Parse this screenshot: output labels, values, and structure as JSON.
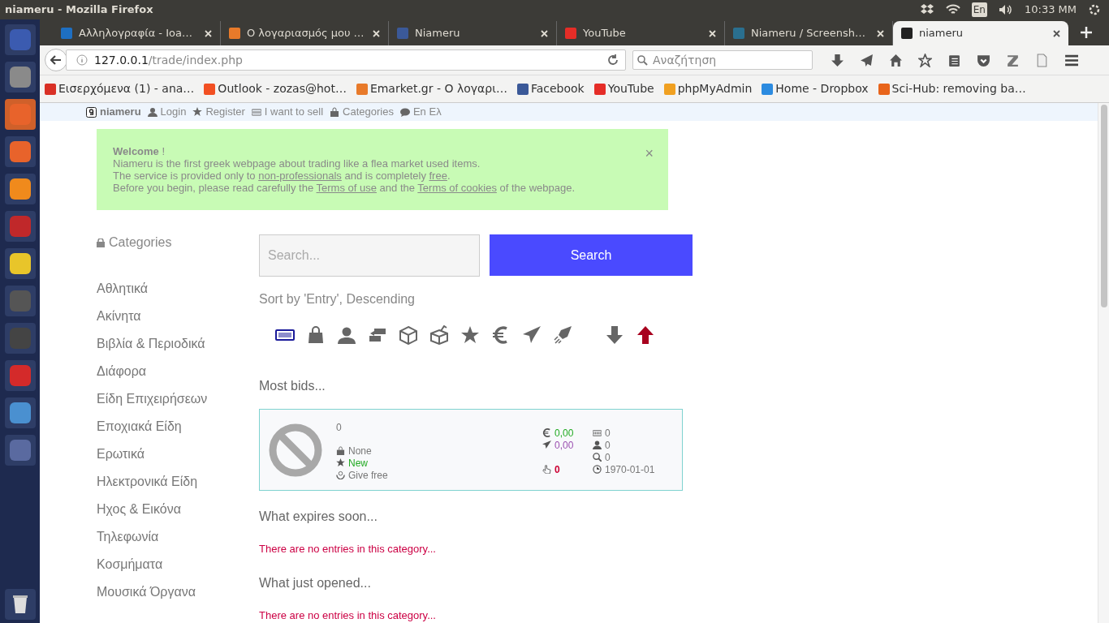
{
  "desktop_bar": {
    "title": "niameru - Mozilla Firefox",
    "keyboard": "En",
    "time": "10:33 MM"
  },
  "launcher": {
    "apps": [
      {
        "color": "#3b5bb0"
      },
      {
        "color": "#8a8a8a"
      },
      {
        "color": "#e8632b"
      },
      {
        "color": "#e8632b"
      },
      {
        "color": "#f08a1c"
      },
      {
        "color": "#c0282a"
      },
      {
        "color": "#e8c52a"
      },
      {
        "color": "#555555"
      },
      {
        "color": "#444444"
      },
      {
        "color": "#d42a2a"
      },
      {
        "color": "#4a90d0"
      },
      {
        "color": "#5a6aa0"
      }
    ],
    "trash": true
  },
  "tabs": [
    {
      "title": "Αλληλογραφία - Ioa…",
      "color": "#1e6fc2",
      "selected": false
    },
    {
      "title": "Ο λογαριασμός μου …",
      "color": "#e87a2a",
      "selected": false
    },
    {
      "title": "Niameru",
      "color": "#3b5998",
      "selected": false
    },
    {
      "title": "YouTube",
      "color": "#e52d27",
      "selected": false
    },
    {
      "title": "Niameru / Screensh…",
      "color": "#2a6f8f",
      "selected": false
    },
    {
      "title": "niameru",
      "color": "#222222",
      "selected": true
    }
  ],
  "url": {
    "host": "127.0.0.1",
    "path": "/trade/index.php"
  },
  "search": {
    "placeholder": "Αναζήτηση"
  },
  "bookmarks": [
    {
      "title": "Εισερχόμενα (1) - ana…",
      "color": "#d93025"
    },
    {
      "title": "Outlook - zozas@hot…",
      "color": "#f25022"
    },
    {
      "title": "Emarket.gr - Ο λογαρι…",
      "color": "#e87a2a"
    },
    {
      "title": "Facebook",
      "color": "#3b5998"
    },
    {
      "title": "YouTube",
      "color": "#e52d27"
    },
    {
      "title": "phpMyAdmin",
      "color": "#f0a020"
    },
    {
      "title": "Home - Dropbox",
      "color": "#2c8be0"
    },
    {
      "title": "Sci-Hub: removing ba…",
      "color": "#e8641a"
    }
  ],
  "site_nav": {
    "brand": "niameru",
    "links": [
      "Login",
      "Register",
      "I want to sell",
      "Categories",
      "En Ελ"
    ]
  },
  "alert": {
    "title": "Welcome",
    "title_tail": " !",
    "close": "×",
    "lines": [
      [
        {
          "kind": "text",
          "text": "Niameru is the first greek webpage about trading like a flea market used items."
        }
      ],
      [
        {
          "kind": "text",
          "text": "The service is provided only to "
        },
        {
          "kind": "link",
          "text": "non-professionals"
        },
        {
          "kind": "text",
          "text": " and is completely "
        },
        {
          "kind": "link",
          "text": "free"
        },
        {
          "kind": "text",
          "text": "."
        }
      ],
      [
        {
          "kind": "text",
          "text": "Before you begin, please read carefully the "
        },
        {
          "kind": "link",
          "text": "Terms of use"
        },
        {
          "kind": "text",
          "text": " and the "
        },
        {
          "kind": "link",
          "text": "Terms of cookies"
        },
        {
          "kind": "text",
          "text": " of the webpage."
        }
      ]
    ]
  },
  "sidebar": {
    "heading": "Categories",
    "items": [
      "Αθλητικά",
      "Ακίνητα",
      "Βιβλία & Περιοδικά",
      "Διάφορα",
      "Είδη Επιχειρήσεων",
      "Εποχιακά Είδη",
      "Ερωτικά",
      "Ηλεκτρονικά Είδη",
      "Ηχος & Εικόνα",
      "Τηλεφωνία",
      "Κοσμήματα",
      "Μουσικά Όργανα"
    ]
  },
  "search_form": {
    "placeholder": "Search...",
    "button": "Search"
  },
  "sort": {
    "label": "Sort by 'Entry', Descending",
    "fields": [
      {
        "selected": true
      },
      {
        "selected": false
      },
      {
        "selected": false
      },
      {
        "selected": false
      },
      {
        "selected": false
      },
      {
        "selected": false
      },
      {
        "selected": false
      },
      {
        "selected": false
      },
      {
        "selected": false
      },
      {
        "selected": false
      }
    ],
    "directions": [
      {
        "selected": false
      },
      {
        "selected": true
      }
    ]
  },
  "sections": [
    {
      "heading": "Most bids...",
      "entries": [
        {
          "title": "0",
          "category": "None",
          "condition": "New",
          "type": "Give free",
          "price": "0,00",
          "shipping": "0,00",
          "bids": "0",
          "stat_1": "0",
          "stat_2": "0",
          "stat_3": "0",
          "date": "1970-01-01"
        }
      ]
    },
    {
      "heading": "What expires soon...",
      "empty": "There are no entries in this category..."
    },
    {
      "heading": "What just opened...",
      "empty": "There are no entries in this category..."
    }
  ]
}
